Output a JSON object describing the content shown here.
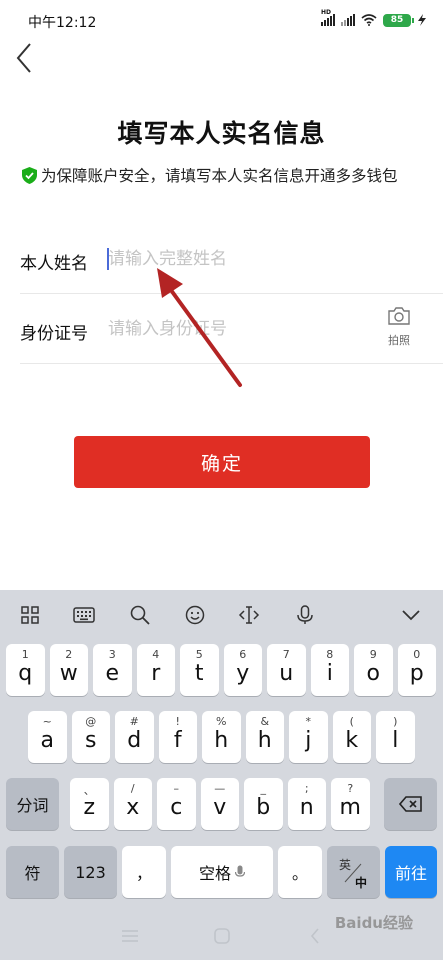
{
  "status_bar": {
    "time": "中午12:12",
    "network": "HD",
    "battery": "85"
  },
  "header": {
    "title": "填写本人实名信息",
    "notice": "为保障账户安全，请填写本人实名信息开通多多钱包"
  },
  "form": {
    "name_label": "本人姓名",
    "name_placeholder": "请输入完整姓名",
    "id_label": "身份证号",
    "id_placeholder": "请输入身份证号",
    "camera_label": "拍照",
    "confirm_label": "确定"
  },
  "keyboard": {
    "row1": [
      {
        "sub": "1",
        "key": "q"
      },
      {
        "sub": "2",
        "key": "w"
      },
      {
        "sub": "3",
        "key": "e"
      },
      {
        "sub": "4",
        "key": "r"
      },
      {
        "sub": "5",
        "key": "t"
      },
      {
        "sub": "6",
        "key": "y"
      },
      {
        "sub": "7",
        "key": "u"
      },
      {
        "sub": "8",
        "key": "i"
      },
      {
        "sub": "9",
        "key": "o"
      },
      {
        "sub": "0",
        "key": "p"
      }
    ],
    "row2": [
      {
        "sub": "~",
        "key": "a"
      },
      {
        "sub": "@",
        "key": "s"
      },
      {
        "sub": "#",
        "key": "d"
      },
      {
        "sub": "!",
        "key": "f"
      },
      {
        "sub": "%",
        "key": "h"
      },
      {
        "sub": "&",
        "key": "h"
      },
      {
        "sub": "*",
        "key": "j"
      },
      {
        "sub": "(",
        "key": "k"
      },
      {
        "sub": ")",
        "key": "l"
      }
    ],
    "row3": [
      {
        "sub": "、",
        "key": "z"
      },
      {
        "sub": "/",
        "key": "x"
      },
      {
        "sub": "–",
        "key": "c"
      },
      {
        "sub": "—",
        "key": "v"
      },
      {
        "sub": "_",
        "key": "b"
      },
      {
        "sub": ";",
        "key": "n"
      },
      {
        "sub": "?",
        "key": "m"
      }
    ],
    "segment_label": "分词",
    "symbol_label": "符",
    "number_label": "123",
    "comma_label": "，",
    "space_label": "空格",
    "period_label": "。",
    "lang_top": "英",
    "lang_bottom": "中",
    "go_label": "前往"
  },
  "watermark": "Baidu经验",
  "colors": {
    "accent": "#e02e24",
    "go_key": "#1e88f3",
    "shield": "#1aad19",
    "arrow": "#b32424"
  }
}
